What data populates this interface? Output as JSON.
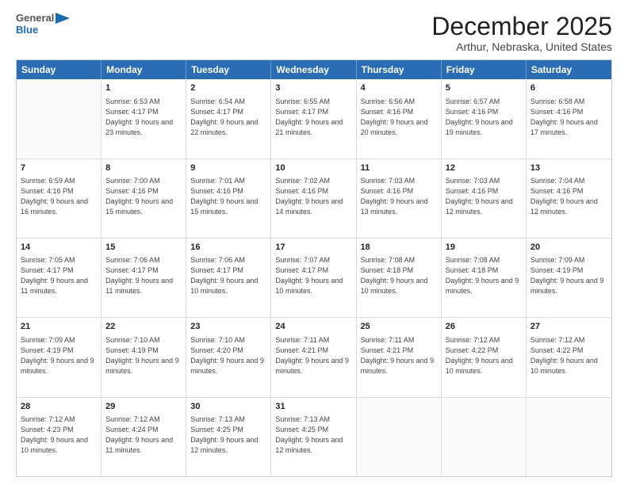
{
  "logo": {
    "general": "General",
    "blue": "Blue"
  },
  "title": "December 2025",
  "subtitle": "Arthur, Nebraska, United States",
  "header_days": [
    "Sunday",
    "Monday",
    "Tuesday",
    "Wednesday",
    "Thursday",
    "Friday",
    "Saturday"
  ],
  "weeks": [
    [
      {
        "day": "",
        "sunrise": "",
        "sunset": "",
        "daylight": ""
      },
      {
        "day": "1",
        "sunrise": "Sunrise: 6:53 AM",
        "sunset": "Sunset: 4:17 PM",
        "daylight": "Daylight: 9 hours and 23 minutes."
      },
      {
        "day": "2",
        "sunrise": "Sunrise: 6:54 AM",
        "sunset": "Sunset: 4:17 PM",
        "daylight": "Daylight: 9 hours and 22 minutes."
      },
      {
        "day": "3",
        "sunrise": "Sunrise: 6:55 AM",
        "sunset": "Sunset: 4:17 PM",
        "daylight": "Daylight: 9 hours and 21 minutes."
      },
      {
        "day": "4",
        "sunrise": "Sunrise: 6:56 AM",
        "sunset": "Sunset: 4:16 PM",
        "daylight": "Daylight: 9 hours and 20 minutes."
      },
      {
        "day": "5",
        "sunrise": "Sunrise: 6:57 AM",
        "sunset": "Sunset: 4:16 PM",
        "daylight": "Daylight: 9 hours and 19 minutes."
      },
      {
        "day": "6",
        "sunrise": "Sunrise: 6:58 AM",
        "sunset": "Sunset: 4:16 PM",
        "daylight": "Daylight: 9 hours and 17 minutes."
      }
    ],
    [
      {
        "day": "7",
        "sunrise": "Sunrise: 6:59 AM",
        "sunset": "Sunset: 4:16 PM",
        "daylight": "Daylight: 9 hours and 16 minutes."
      },
      {
        "day": "8",
        "sunrise": "Sunrise: 7:00 AM",
        "sunset": "Sunset: 4:16 PM",
        "daylight": "Daylight: 9 hours and 15 minutes."
      },
      {
        "day": "9",
        "sunrise": "Sunrise: 7:01 AM",
        "sunset": "Sunset: 4:16 PM",
        "daylight": "Daylight: 9 hours and 15 minutes."
      },
      {
        "day": "10",
        "sunrise": "Sunrise: 7:02 AM",
        "sunset": "Sunset: 4:16 PM",
        "daylight": "Daylight: 9 hours and 14 minutes."
      },
      {
        "day": "11",
        "sunrise": "Sunrise: 7:03 AM",
        "sunset": "Sunset: 4:16 PM",
        "daylight": "Daylight: 9 hours and 13 minutes."
      },
      {
        "day": "12",
        "sunrise": "Sunrise: 7:03 AM",
        "sunset": "Sunset: 4:16 PM",
        "daylight": "Daylight: 9 hours and 12 minutes."
      },
      {
        "day": "13",
        "sunrise": "Sunrise: 7:04 AM",
        "sunset": "Sunset: 4:16 PM",
        "daylight": "Daylight: 9 hours and 12 minutes."
      }
    ],
    [
      {
        "day": "14",
        "sunrise": "Sunrise: 7:05 AM",
        "sunset": "Sunset: 4:17 PM",
        "daylight": "Daylight: 9 hours and 11 minutes."
      },
      {
        "day": "15",
        "sunrise": "Sunrise: 7:06 AM",
        "sunset": "Sunset: 4:17 PM",
        "daylight": "Daylight: 9 hours and 11 minutes."
      },
      {
        "day": "16",
        "sunrise": "Sunrise: 7:06 AM",
        "sunset": "Sunset: 4:17 PM",
        "daylight": "Daylight: 9 hours and 10 minutes."
      },
      {
        "day": "17",
        "sunrise": "Sunrise: 7:07 AM",
        "sunset": "Sunset: 4:17 PM",
        "daylight": "Daylight: 9 hours and 10 minutes."
      },
      {
        "day": "18",
        "sunrise": "Sunrise: 7:08 AM",
        "sunset": "Sunset: 4:18 PM",
        "daylight": "Daylight: 9 hours and 10 minutes."
      },
      {
        "day": "19",
        "sunrise": "Sunrise: 7:08 AM",
        "sunset": "Sunset: 4:18 PM",
        "daylight": "Daylight: 9 hours and 9 minutes."
      },
      {
        "day": "20",
        "sunrise": "Sunrise: 7:09 AM",
        "sunset": "Sunset: 4:19 PM",
        "daylight": "Daylight: 9 hours and 9 minutes."
      }
    ],
    [
      {
        "day": "21",
        "sunrise": "Sunrise: 7:09 AM",
        "sunset": "Sunset: 4:19 PM",
        "daylight": "Daylight: 9 hours and 9 minutes."
      },
      {
        "day": "22",
        "sunrise": "Sunrise: 7:10 AM",
        "sunset": "Sunset: 4:19 PM",
        "daylight": "Daylight: 9 hours and 9 minutes."
      },
      {
        "day": "23",
        "sunrise": "Sunrise: 7:10 AM",
        "sunset": "Sunset: 4:20 PM",
        "daylight": "Daylight: 9 hours and 9 minutes."
      },
      {
        "day": "24",
        "sunrise": "Sunrise: 7:11 AM",
        "sunset": "Sunset: 4:21 PM",
        "daylight": "Daylight: 9 hours and 9 minutes."
      },
      {
        "day": "25",
        "sunrise": "Sunrise: 7:11 AM",
        "sunset": "Sunset: 4:21 PM",
        "daylight": "Daylight: 9 hours and 9 minutes."
      },
      {
        "day": "26",
        "sunrise": "Sunrise: 7:12 AM",
        "sunset": "Sunset: 4:22 PM",
        "daylight": "Daylight: 9 hours and 10 minutes."
      },
      {
        "day": "27",
        "sunrise": "Sunrise: 7:12 AM",
        "sunset": "Sunset: 4:22 PM",
        "daylight": "Daylight: 9 hours and 10 minutes."
      }
    ],
    [
      {
        "day": "28",
        "sunrise": "Sunrise: 7:12 AM",
        "sunset": "Sunset: 4:23 PM",
        "daylight": "Daylight: 9 hours and 10 minutes."
      },
      {
        "day": "29",
        "sunrise": "Sunrise: 7:12 AM",
        "sunset": "Sunset: 4:24 PM",
        "daylight": "Daylight: 9 hours and 11 minutes."
      },
      {
        "day": "30",
        "sunrise": "Sunrise: 7:13 AM",
        "sunset": "Sunset: 4:25 PM",
        "daylight": "Daylight: 9 hours and 12 minutes."
      },
      {
        "day": "31",
        "sunrise": "Sunrise: 7:13 AM",
        "sunset": "Sunset: 4:25 PM",
        "daylight": "Daylight: 9 hours and 12 minutes."
      },
      {
        "day": "",
        "sunrise": "",
        "sunset": "",
        "daylight": ""
      },
      {
        "day": "",
        "sunrise": "",
        "sunset": "",
        "daylight": ""
      },
      {
        "day": "",
        "sunrise": "",
        "sunset": "",
        "daylight": ""
      }
    ]
  ]
}
